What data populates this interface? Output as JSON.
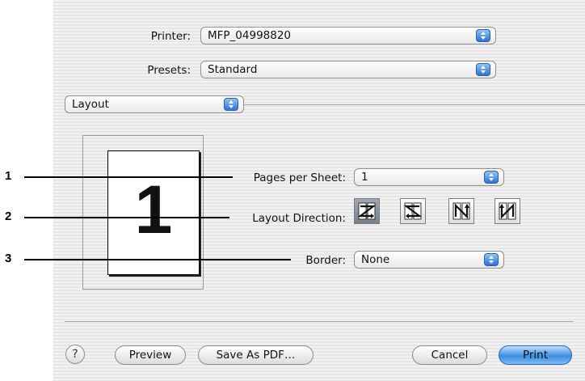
{
  "printer": {
    "label": "Printer:",
    "value": "MFP_04998820"
  },
  "presets": {
    "label": "Presets:",
    "value": "Standard"
  },
  "pane": {
    "value": "Layout"
  },
  "preview": {
    "page_number": "1"
  },
  "callouts": [
    "1",
    "2",
    "3"
  ],
  "pages_per_sheet": {
    "label": "Pages per Sheet:",
    "value": "1"
  },
  "layout_direction": {
    "label": "Layout Direction:",
    "options": [
      "Z-order (left to right, top to bottom)",
      "Reverse Z-order",
      "N-order (top to bottom, left to right)",
      "Reverse N-order"
    ],
    "selected_index": 0
  },
  "border": {
    "label": "Border:",
    "value": "None"
  },
  "buttons": {
    "help": "?",
    "preview": "Preview",
    "save_pdf": "Save As PDF…",
    "cancel": "Cancel",
    "print": "Print"
  },
  "colors": {
    "accent": "#3c8ee3",
    "selected_dir": "#8a929e"
  }
}
